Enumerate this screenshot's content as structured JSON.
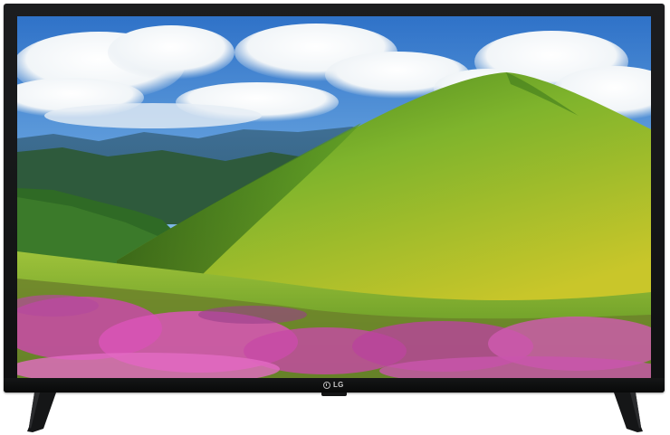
{
  "product": {
    "brand_label": "LG",
    "logo_icon": "lg-logo-icon"
  },
  "screen": {
    "content": "landscape-wallpaper"
  },
  "colors": {
    "bezel": "#141516",
    "sky": "#6aa6dd",
    "hill_green": "#7fb42c",
    "flowers": "#d84fb5"
  }
}
